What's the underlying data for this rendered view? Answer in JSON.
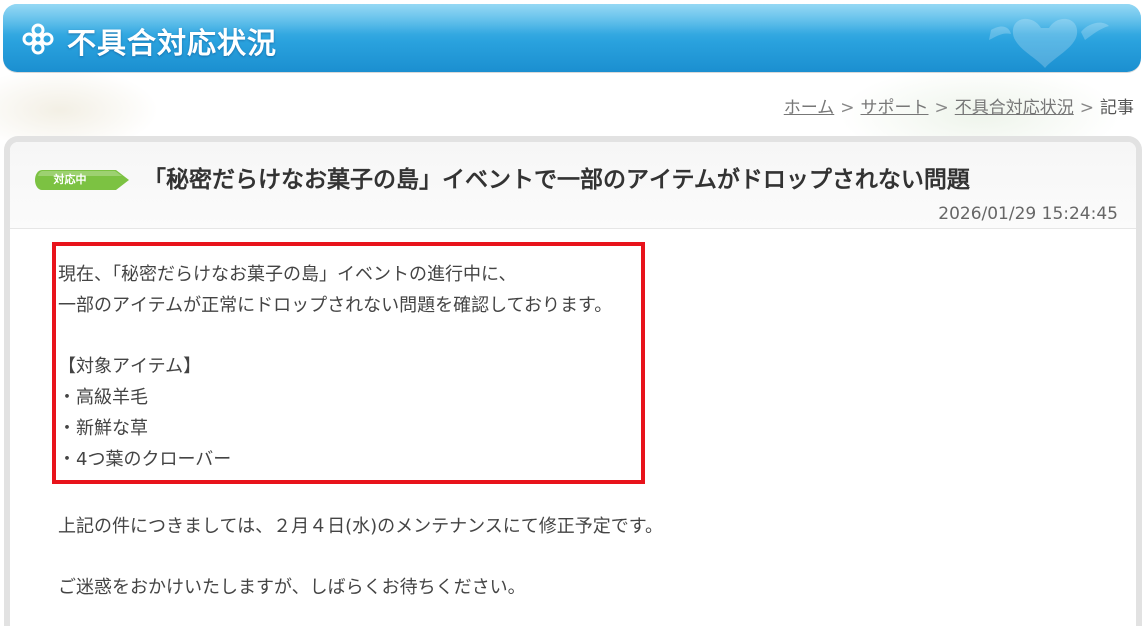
{
  "header": {
    "title": "不具合対応状況"
  },
  "breadcrumb": {
    "home": "ホーム",
    "support": "サポート",
    "status": "不具合対応状況",
    "current": "記事",
    "separator": ">"
  },
  "article": {
    "status_badge": "対応中",
    "title": "「秘密だらけなお菓子の島」イベントで一部のアイテムがドロップされない問題",
    "date": "2026/01/29 15:24:45",
    "intro_line1": "現在、「秘密だらけなお菓子の島」イベントの進行中に、",
    "intro_line2": "一部のアイテムが正常にドロップされない問題を確認しております。",
    "items_heading": "【対象アイテム】",
    "items": [
      "・高級羊毛",
      "・新鮮な草",
      "・4つ葉のクローバー"
    ],
    "fix_notice": "上記の件につきましては、２月４日(水)のメンテナンスにて修正予定です。",
    "apology": "ご迷惑をおかけいたしますが、しばらくお待ちください。"
  },
  "colors": {
    "banner": "#2aa2de",
    "badge": "#7cc242",
    "highlight": "#e8131b"
  }
}
